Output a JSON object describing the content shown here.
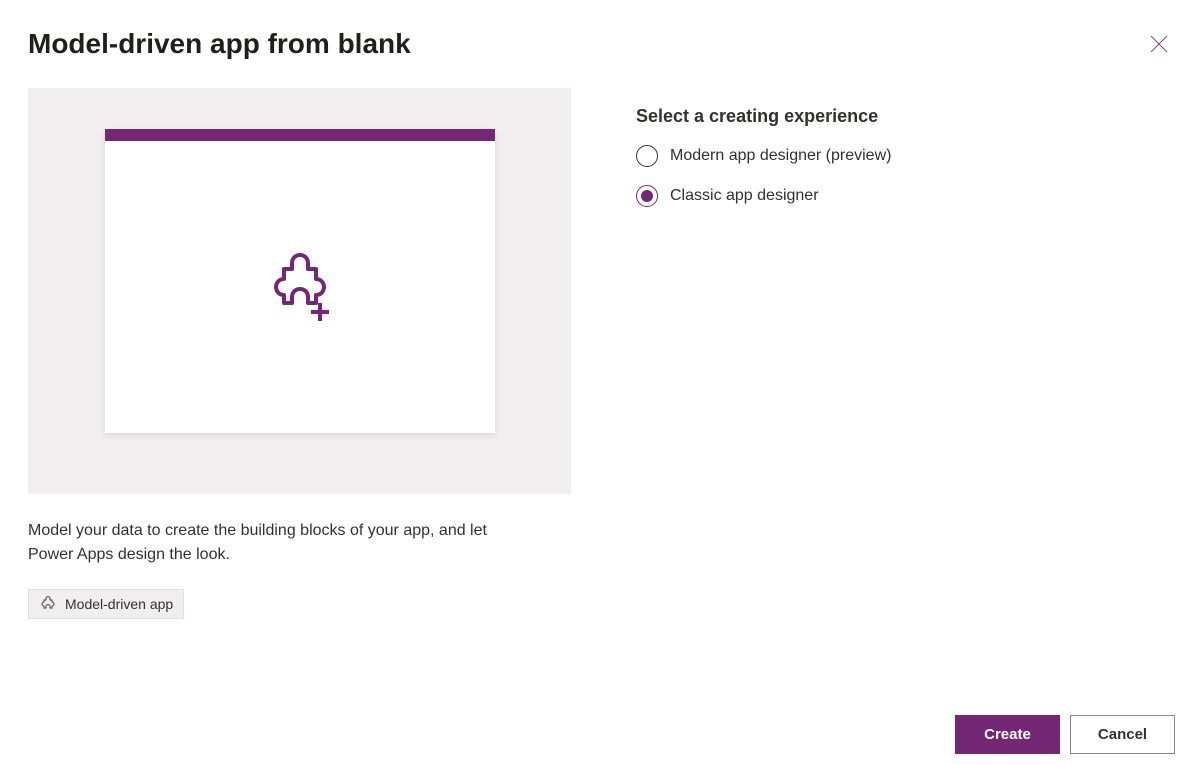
{
  "dialog": {
    "title": "Model-driven app from blank"
  },
  "preview": {
    "description": "Model your data to create the building blocks of your app, and let Power Apps design the look.",
    "tag_label": "Model-driven app"
  },
  "experience": {
    "heading": "Select a creating experience",
    "options": {
      "modern": "Modern app designer (preview)",
      "classic": "Classic app designer"
    },
    "selected": "classic"
  },
  "actions": {
    "create": "Create",
    "cancel": "Cancel"
  }
}
